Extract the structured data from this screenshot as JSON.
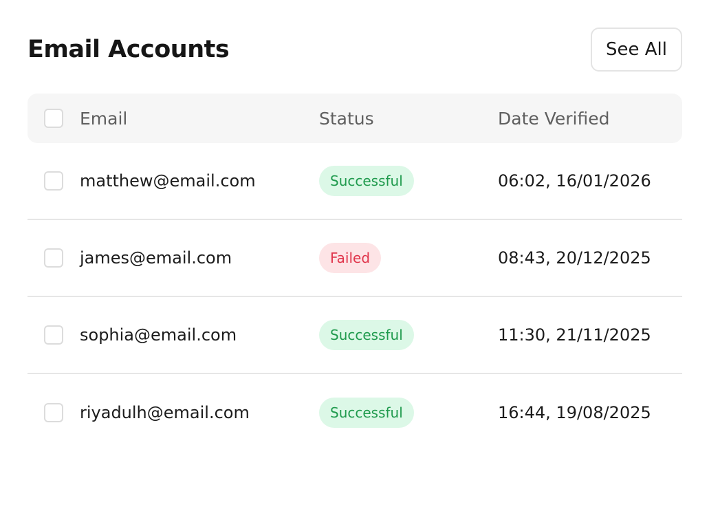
{
  "header": {
    "title": "Email Accounts",
    "see_all_label": "See All"
  },
  "table": {
    "columns": {
      "email": "Email",
      "status": "Status",
      "date": "Date Verified"
    },
    "rows": [
      {
        "email": "matthew@email.com",
        "status": "Successful",
        "date": "06:02, 16/01/2026"
      },
      {
        "email": "james@email.com",
        "status": "Failed",
        "date": "08:43, 20/12/2025"
      },
      {
        "email": "sophia@email.com",
        "status": "Successful",
        "date": "11:30, 21/11/2025"
      },
      {
        "email": "riyadulh@email.com",
        "status": "Successful",
        "date": "16:44, 19/08/2025"
      }
    ]
  },
  "colors": {
    "success_bg": "#dcf8e7",
    "success_text": "#1f9a4d",
    "failed_bg": "#fde4e6",
    "failed_text": "#e0344a"
  }
}
